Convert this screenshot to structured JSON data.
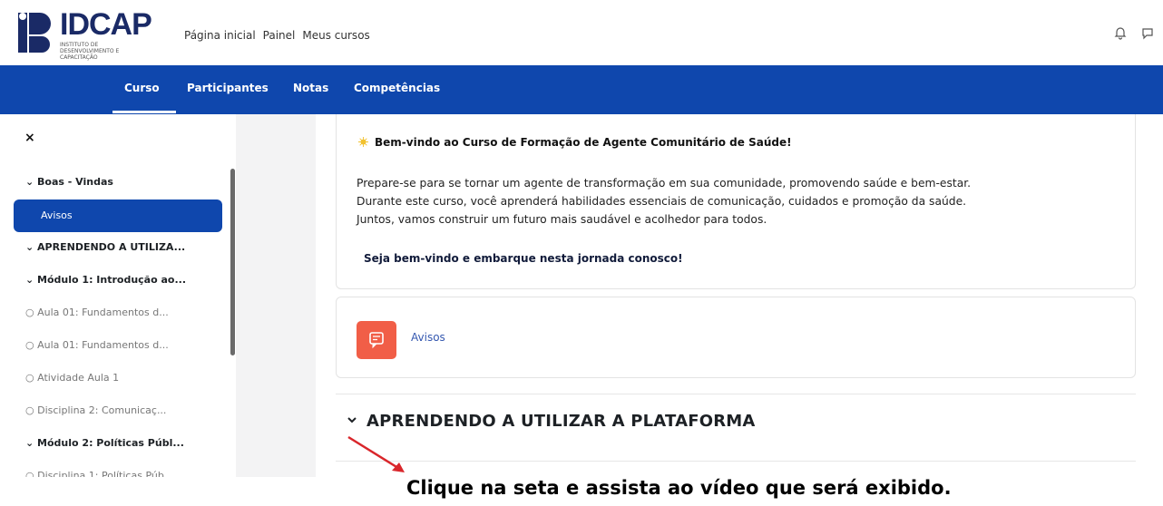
{
  "logo": {
    "name": "IDCAP",
    "subtitle": "INSTITUTO DE DESENVOLVIMENTO E CAPACITAÇÃO"
  },
  "topnav": {
    "items": [
      "Página inicial",
      "Painel",
      "Meus cursos"
    ]
  },
  "topicons": [
    "bell-icon",
    "chat-icon"
  ],
  "secondary_nav": {
    "tabs": [
      "Curso",
      "Participantes",
      "Notas",
      "Competências"
    ],
    "active": "Curso"
  },
  "sidebar": {
    "close": "×",
    "items": [
      {
        "label": "Boas - Vindas",
        "type": "section"
      },
      {
        "label": "Avisos",
        "type": "active"
      },
      {
        "label": "APRENDENDO A UTILIZA...",
        "type": "section"
      },
      {
        "label": "Módulo 1: Introdução ao...",
        "type": "section"
      },
      {
        "label": "Aula 01: Fundamentos d...",
        "type": "activity"
      },
      {
        "label": "Aula 01: Fundamentos d...",
        "type": "activity"
      },
      {
        "label": "Atividade Aula 1",
        "type": "activity"
      },
      {
        "label": "Disciplina 2: Comunicaç...",
        "type": "activity"
      },
      {
        "label": "Módulo 2: Políticas Públ...",
        "type": "section"
      },
      {
        "label": "Disciplina 1: Políticas Púb...",
        "type": "activity"
      }
    ]
  },
  "main": {
    "welcome": "Bem-vindo ao Curso de Formação de Agente Comunitário de Saúde!",
    "paragraph": [
      "Prepare-se para se tornar um agente de transformação em sua comunidade, promovendo saúde e bem-estar.",
      "Durante este curso, você aprenderá habilidades essenciais de comunicação, cuidados e promoção da saúde.",
      "Juntos, vamos construir um futuro mais saudável e acolhedor para todos."
    ],
    "cta": "Seja bem-vindo e embarque nesta jornada conosco!",
    "avisos_link": "Avisos",
    "section_title": "APRENDENDO A UTILIZAR A PLATAFORMA"
  },
  "caption": "Clique na seta e assista ao vídeo que será exibido.",
  "colors": {
    "primary": "#0f47ad",
    "avisos_icon": "#f15e47",
    "arrow": "#d9262b"
  }
}
